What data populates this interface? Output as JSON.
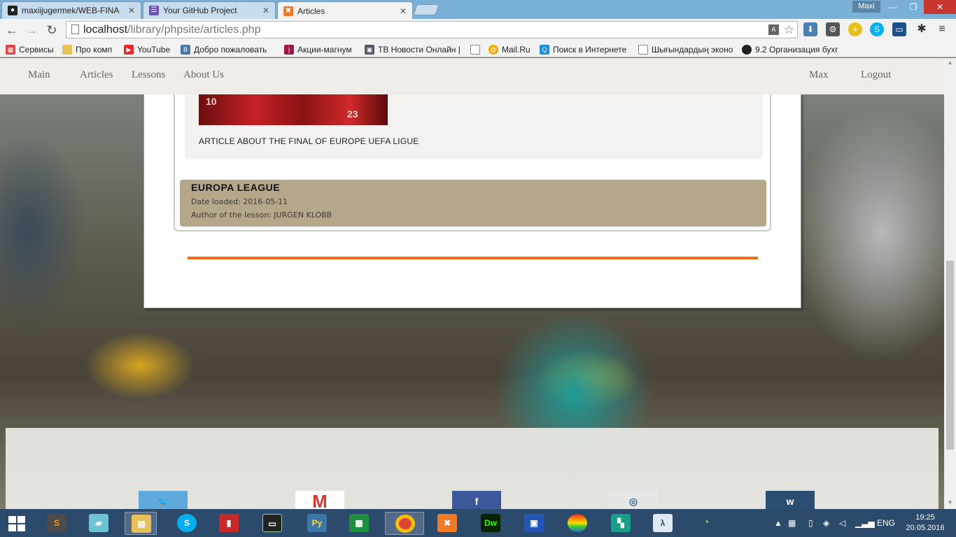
{
  "browser": {
    "tabs": [
      {
        "title": "maxiijugermek/WEB-FINA",
        "icon": "github-icon"
      },
      {
        "title": "Your GitHub Project",
        "icon": "list-icon"
      },
      {
        "title": "Articles",
        "icon": "xampp-icon",
        "active": true
      }
    ],
    "profile_name": "Maxi",
    "window_controls": {
      "minimize": "—",
      "restore": "❐",
      "close": "✕"
    },
    "address": {
      "host": "localhost",
      "path": "/library/phpsite/articles.php"
    },
    "bookmarks": [
      {
        "label": "Сервисы",
        "icon": "apps-grid-icon"
      },
      {
        "label": "Про комп",
        "icon": "folder-icon"
      },
      {
        "label": "YouTube",
        "icon": "youtube-icon"
      },
      {
        "label": "Добро пожаловать",
        "icon": "vk-icon"
      },
      {
        "label": "Акции-магнум",
        "icon": "magnum-icon"
      },
      {
        "label": "ТВ Новости Онлайн |",
        "icon": "tv-icon"
      },
      {
        "label": "",
        "icon": "page-icon"
      },
      {
        "label": "Mail.Ru",
        "icon": "mailru-icon"
      },
      {
        "label": "Поиск в Интернете",
        "icon": "search-icon"
      },
      {
        "label": "Шығындардың эконо",
        "icon": "page-icon"
      },
      {
        "label": "9.2 Организация бухг",
        "icon": "ball-icon"
      }
    ]
  },
  "site": {
    "nav": {
      "main": "Main",
      "articles": "Articles",
      "lessons": "Lessons",
      "about": "About Us",
      "user": "Max",
      "logout": "Logout"
    },
    "article": {
      "text": "ARTICLE ABOUT THE FINAL OF EUROPE UEFA LIGUE"
    },
    "card": {
      "title": "EUROPA LEAGUE",
      "date": "Date loaded: 2016-05-11",
      "author": "Author of the lesson: JURGEN KLOBB"
    },
    "accent_color": "#ee6f1b",
    "social": [
      "twitter-icon",
      "gmail-icon",
      "facebook-icon",
      "instagram-icon",
      "vk-icon"
    ]
  },
  "taskbar": {
    "language": "ENG",
    "time": "19:25",
    "date": "20.05.2016"
  }
}
